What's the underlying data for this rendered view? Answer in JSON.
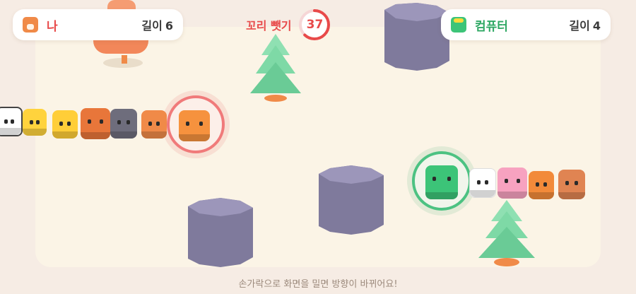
{
  "player": {
    "name": "나",
    "length_label": "길이",
    "length": "6",
    "avatar": "fox-avatar-icon",
    "color": "#e84a4a"
  },
  "opponent": {
    "name": "컴퓨터",
    "length_label": "길이",
    "length": "4",
    "avatar": "dino-avatar-icon",
    "color": "#2fa864"
  },
  "timer": {
    "label": "꼬리 뺏기",
    "value": "37",
    "progress": 0.62,
    "color": "#e84a4a"
  },
  "hint": "손가락으로 화면을 밀면 방향이 바뀌어요!",
  "player_tail": [
    "panda-icon",
    "chick-icon",
    "bee-icon",
    "bear-icon",
    "cat-icon",
    "fox-icon"
  ],
  "opponent_tail": [
    "cow-icon",
    "pig-icon",
    "clownfish-icon",
    "deer-icon"
  ],
  "colors": {
    "arena": "#fbf4e6",
    "background": "#f6ece4",
    "rock": "#8d87a8",
    "tree": "#7ed9a6",
    "trunk": "#f08a48"
  }
}
